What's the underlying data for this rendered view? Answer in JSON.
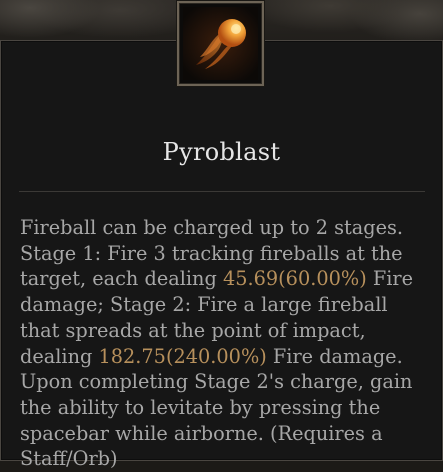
{
  "skill": {
    "icon": "fireball-icon",
    "name": "Pyroblast",
    "description_lines": [
      [
        {
          "text": "Fireball can be charged up to 2 stages."
        }
      ],
      [
        {
          "text": "Stage 1: Fire 3 tracking fireballs at the"
        }
      ],
      [
        {
          "text": "target, each dealing "
        },
        {
          "text": "45.69(60.00%)",
          "highlight": true
        },
        {
          "text": " Fire"
        }
      ],
      [
        {
          "text": "damage; Stage 2: Fire a large fireball"
        }
      ],
      [
        {
          "text": "that spreads at the point of impact,"
        }
      ],
      [
        {
          "text": "dealing "
        },
        {
          "text": "182.75(240.00%)",
          "highlight": true
        },
        {
          "text": " Fire damage."
        }
      ],
      [
        {
          "text": "Upon completing Stage 2's charge, gain"
        }
      ],
      [
        {
          "text": "the ability to levitate by pressing the"
        }
      ],
      [
        {
          "text": "spacebar while airborne. (Requires a"
        }
      ],
      [
        {
          "text": "Staff/Orb)"
        }
      ]
    ]
  },
  "colors": {
    "panel_background": "#161616",
    "panel_border": "#4a4641",
    "title_text": "#e6e6e6",
    "body_text": "#a7a7a7",
    "highlight_value": "#b7905c"
  }
}
